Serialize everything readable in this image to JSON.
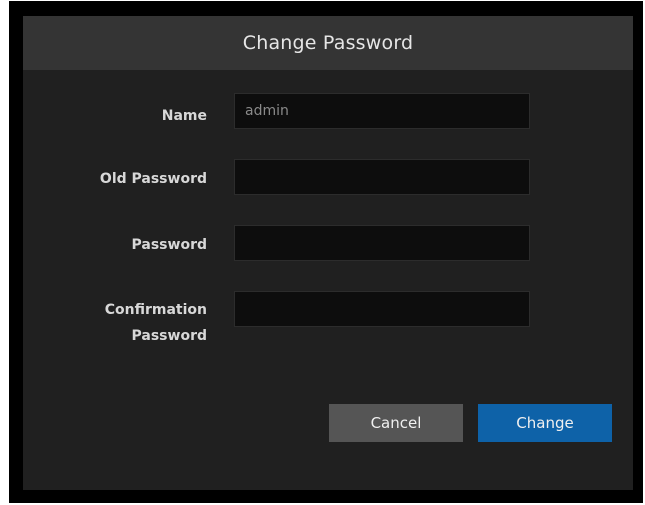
{
  "dialog": {
    "title": "Change Password"
  },
  "form": {
    "name_label": "Name",
    "name_value": "admin",
    "old_password_label": "Old Password",
    "old_password_value": "",
    "password_label": "Password",
    "password_value": "",
    "confirmation_label_line1": "Confirmation",
    "confirmation_label_line2": "Password",
    "confirmation_value": ""
  },
  "actions": {
    "cancel_label": "Cancel",
    "change_label": "Change"
  },
  "colors": {
    "header_bg": "#343434",
    "dialog_bg": "#202020",
    "field_bg": "#0d0d0d",
    "cancel_bg": "#555555",
    "primary_accent": "#0e62a8"
  }
}
